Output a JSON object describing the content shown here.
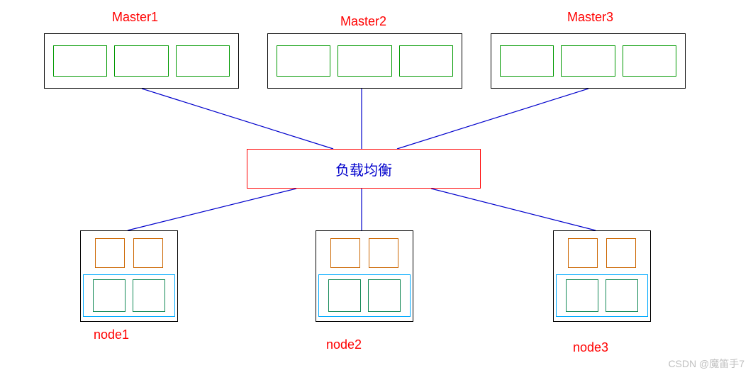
{
  "masters": [
    {
      "label": "Master1"
    },
    {
      "label": "Master2"
    },
    {
      "label": "Master3"
    }
  ],
  "load_balancer": {
    "label": "负载均衡"
  },
  "nodes": [
    {
      "label": "node1"
    },
    {
      "label": "node2"
    },
    {
      "label": "node3"
    }
  ],
  "watermark": "CSDN @魔笛手7"
}
